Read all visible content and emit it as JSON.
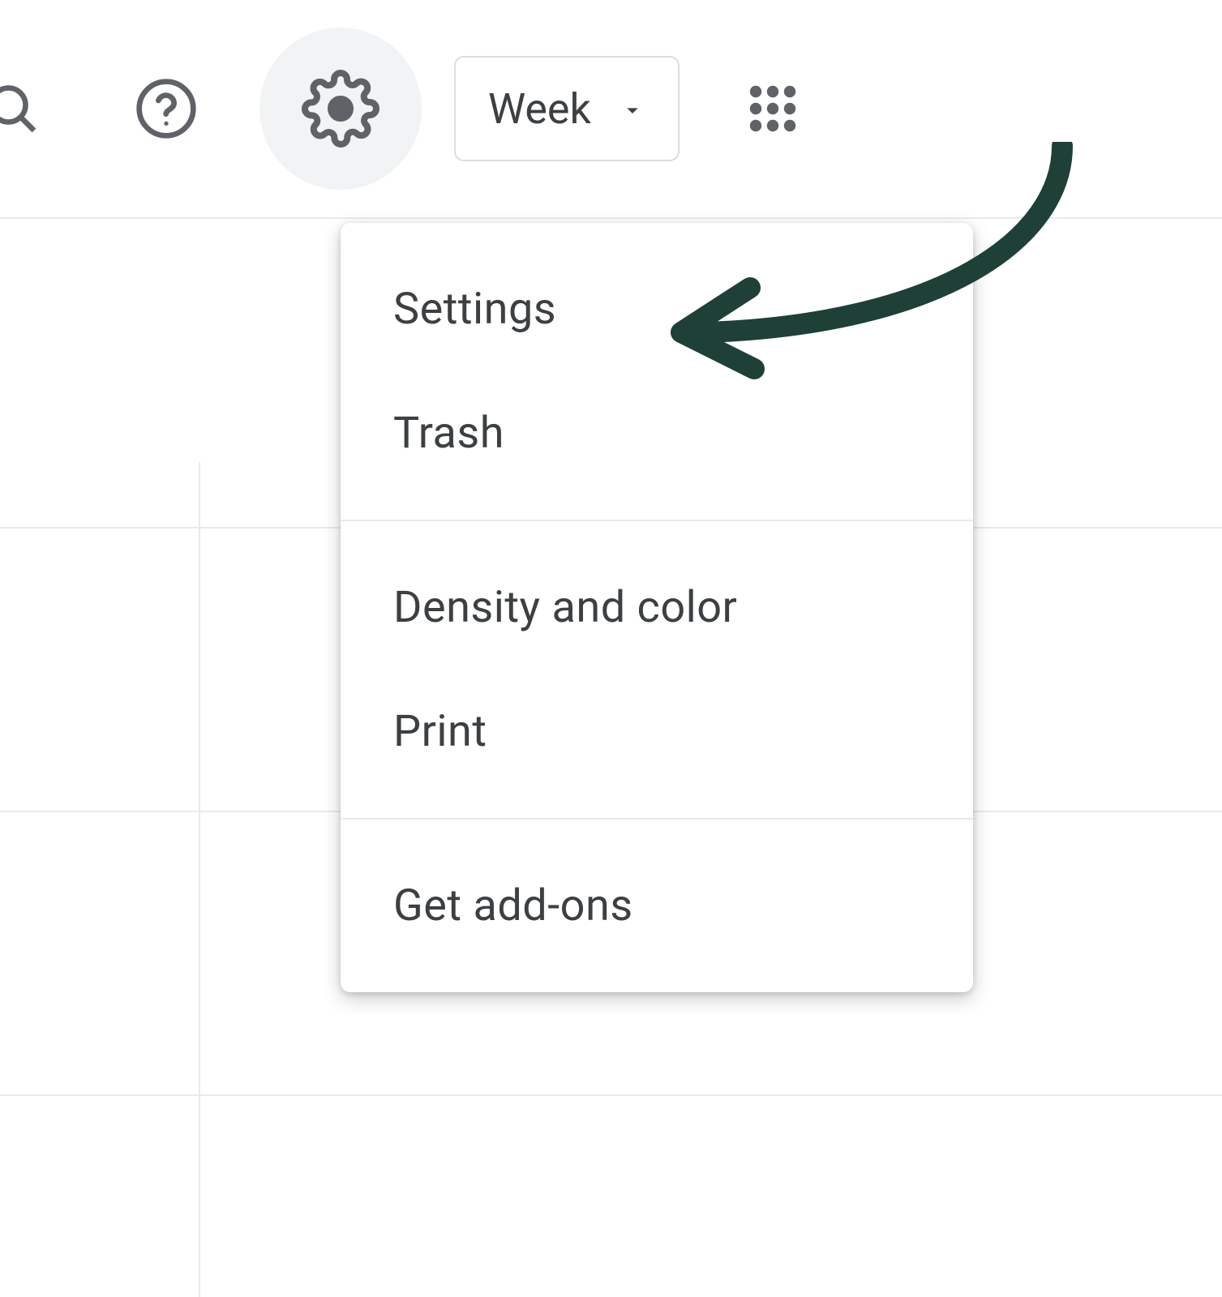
{
  "toolbar": {
    "view_selector": {
      "label": "Week"
    }
  },
  "settings_menu": {
    "items": [
      {
        "label": "Settings"
      },
      {
        "label": "Trash"
      },
      {
        "label": "Density and color"
      },
      {
        "label": "Print"
      },
      {
        "label": "Get add-ons"
      }
    ]
  },
  "annotation": {
    "arrow_color": "#1e4036"
  }
}
